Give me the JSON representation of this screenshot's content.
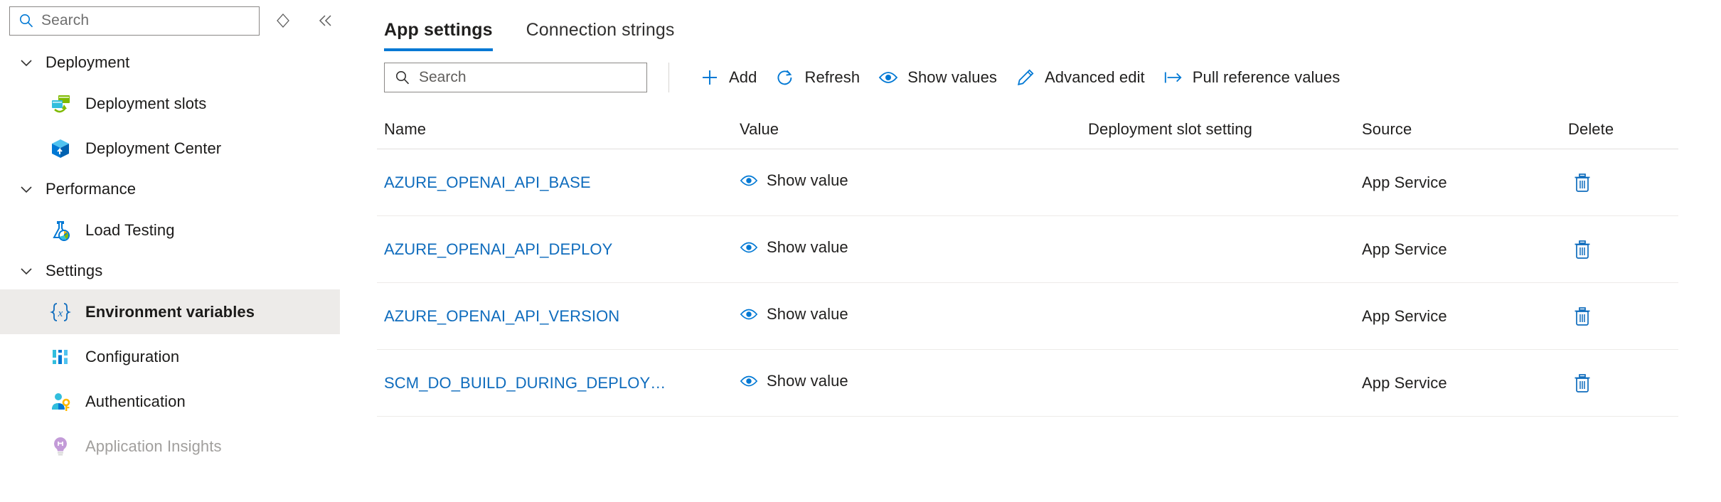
{
  "sidebar": {
    "search": {
      "placeholder": "Search",
      "icon": "search-icon"
    },
    "tools": [
      {
        "name": "expand-collapse-icon",
        "label": ""
      },
      {
        "name": "collapse-panel-icon",
        "label": ""
      }
    ],
    "groups": [
      {
        "label": "Deployment",
        "icon": "chevron-down-icon",
        "items": [
          {
            "label": "Deployment slots",
            "icon": "deployment-slots-icon",
            "selected": false,
            "disabled": false
          },
          {
            "label": "Deployment Center",
            "icon": "deployment-center-icon",
            "selected": false,
            "disabled": false
          }
        ]
      },
      {
        "label": "Performance",
        "icon": "chevron-down-icon",
        "items": [
          {
            "label": "Load Testing",
            "icon": "load-testing-icon",
            "selected": false,
            "disabled": false
          }
        ]
      },
      {
        "label": "Settings",
        "icon": "chevron-down-icon",
        "items": [
          {
            "label": "Environment variables",
            "icon": "environment-variables-icon",
            "selected": true,
            "disabled": false
          },
          {
            "label": "Configuration",
            "icon": "configuration-icon",
            "selected": false,
            "disabled": false
          },
          {
            "label": "Authentication",
            "icon": "authentication-icon",
            "selected": false,
            "disabled": false
          },
          {
            "label": "Application Insights",
            "icon": "application-insights-icon",
            "selected": false,
            "disabled": true
          }
        ]
      }
    ]
  },
  "main": {
    "tabs": [
      {
        "label": "App settings",
        "active": true
      },
      {
        "label": "Connection strings",
        "active": false
      }
    ],
    "toolbar": {
      "search": {
        "placeholder": "Search",
        "icon": "search-icon"
      },
      "buttons": [
        {
          "label": "Add",
          "icon": "plus-icon"
        },
        {
          "label": "Refresh",
          "icon": "refresh-icon"
        },
        {
          "label": "Show values",
          "icon": "eye-icon"
        },
        {
          "label": "Advanced edit",
          "icon": "pencil-icon"
        },
        {
          "label": "Pull reference values",
          "icon": "pull-arrow-icon"
        }
      ]
    },
    "table": {
      "columns": [
        "Name",
        "Value",
        "Deployment slot setting",
        "Source",
        "Delete"
      ],
      "show_value_label": "Show value",
      "rows": [
        {
          "name": "AZURE_OPENAI_API_BASE",
          "value": "Show value",
          "slot_setting": "",
          "source": "App Service",
          "delete": "delete-icon"
        },
        {
          "name": "AZURE_OPENAI_API_DEPLOY",
          "value": "Show value",
          "slot_setting": "",
          "source": "App Service",
          "delete": "delete-icon"
        },
        {
          "name": "AZURE_OPENAI_API_VERSION",
          "value": "Show value",
          "slot_setting": "",
          "source": "App Service",
          "delete": "delete-icon"
        },
        {
          "name": "SCM_DO_BUILD_DURING_DEPLOY…",
          "value": "Show value",
          "slot_setting": "",
          "source": "App Service",
          "delete": "delete-icon"
        }
      ]
    }
  },
  "colors": {
    "accent": "#0078d4",
    "link": "#0f6cbd",
    "selected_bg": "#edebe9",
    "border": "#e1dfdd",
    "text": "#201f1e",
    "disabled_text": "#a19f9d"
  }
}
